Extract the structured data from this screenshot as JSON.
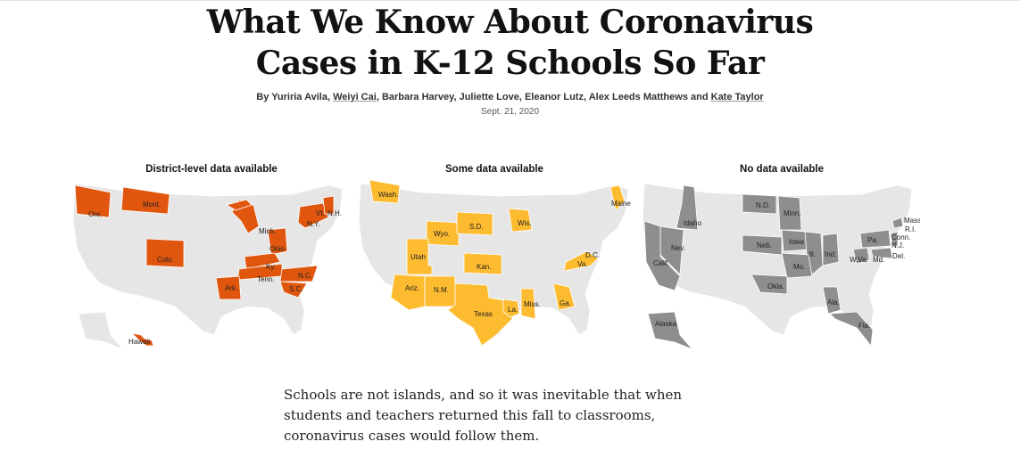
{
  "headline": {
    "line1": "What We Know About Coronavirus",
    "line2": "Cases in K-12 Schools So Far"
  },
  "byline": {
    "prefix": "By ",
    "authors": [
      "Yuriria Avila",
      "Weiyi Cai",
      "Barbara Harvey",
      "Juliette Love",
      "Eleanor Lutz",
      "Alex Leeds Matthews",
      "Kate Taylor"
    ],
    "sep1": ", ",
    "sep2": ", ",
    "sep3": ", ",
    "sep4": ", ",
    "sep5": ", ",
    "and": " and "
  },
  "date": "Sept. 21, 2020",
  "maps": [
    {
      "title": "District-level data available",
      "color": "#e0560f",
      "states": [
        "Ore.",
        "Mont.",
        "Colo.",
        "Mich.",
        "Ohio",
        "Ky.",
        "Tenn.",
        "Ark.",
        "N.C.",
        "S.C.",
        "N.Y.",
        "Vt.",
        "N.H.",
        "Hawaii"
      ]
    },
    {
      "title": "Some data available",
      "color": "#fdbb30",
      "states": [
        "Wash.",
        "Wyo.",
        "S.D.",
        "Utah",
        "Kan.",
        "Ariz.",
        "N.M.",
        "Texas",
        "La.",
        "Miss.",
        "Ga.",
        "Wis.",
        "Maine",
        "D.C.",
        "Va."
      ]
    },
    {
      "title": "No data available",
      "color": "#8e8e8e",
      "states": [
        "N.D.",
        "Minn.",
        "Idaho",
        "Nev.",
        "Calif.",
        "Neb.",
        "Iowa",
        "Ill.",
        "Ind.",
        "Mo.",
        "Okla.",
        "Ala.",
        "Fla.",
        "Alaska",
        "Pa.",
        "W.Va.",
        "Md.",
        "Del.",
        "Mass.",
        "R.I.",
        "Conn.",
        "N.J."
      ]
    }
  ],
  "body": "Schools are not islands, and so it was inevitable that when students and teachers returned this fall to classrooms, coronavirus cases would follow them."
}
